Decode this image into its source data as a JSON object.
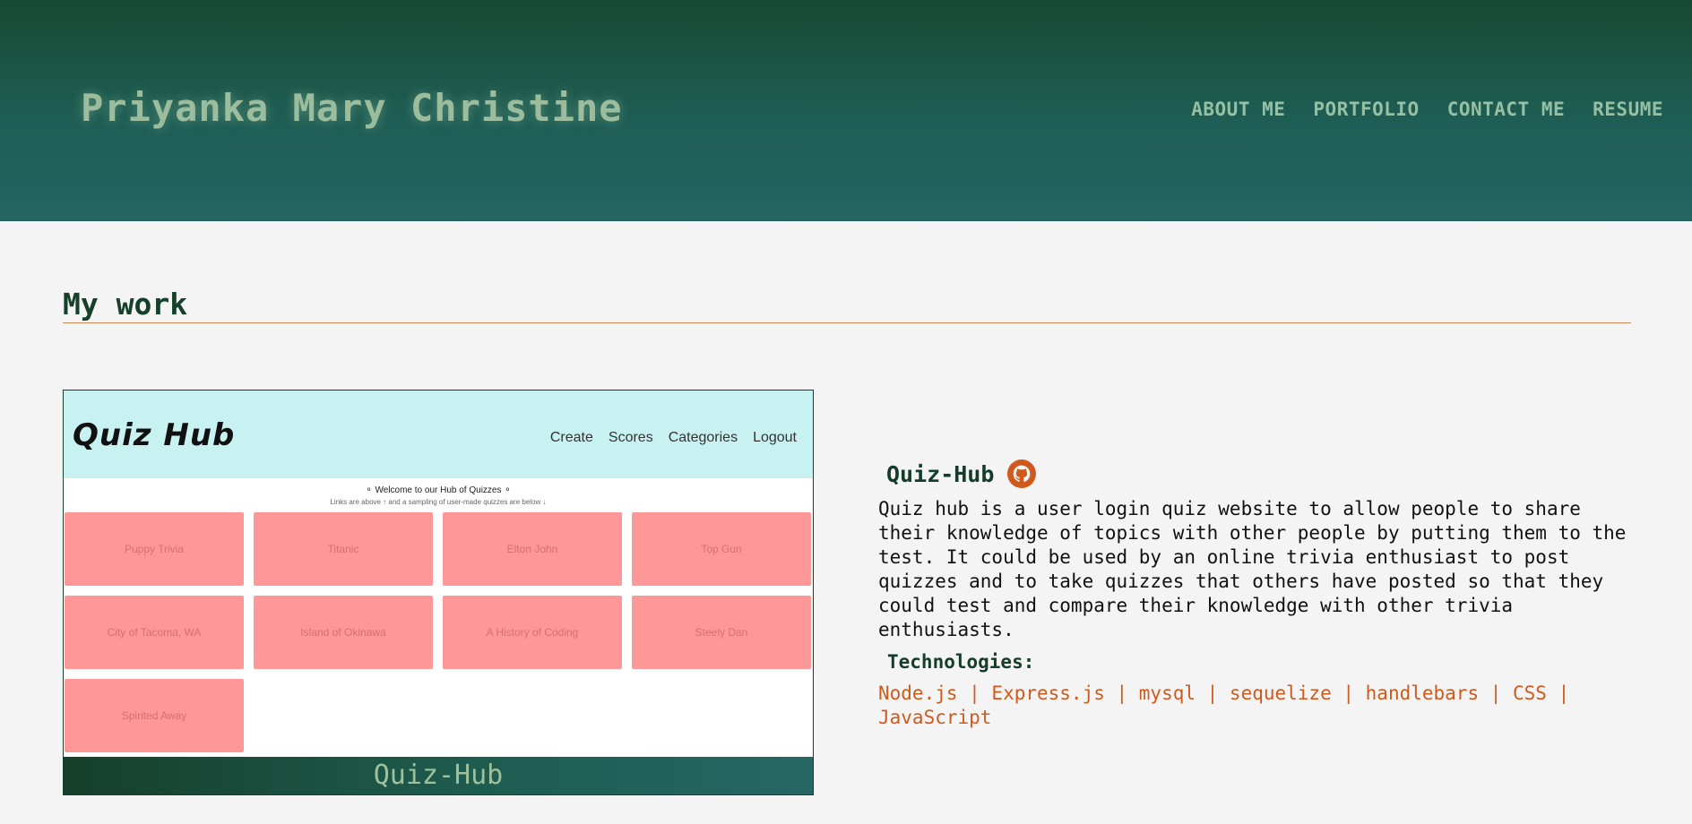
{
  "header": {
    "site_title": "Priyanka Mary Christine",
    "nav": [
      "ABOUT ME",
      "PORTFOLIO",
      "CONTACT ME",
      "RESUME"
    ]
  },
  "section": {
    "title": "My work"
  },
  "project": {
    "screenshot": {
      "logo": "Quiz Hub",
      "nav": [
        "Create",
        "Scores",
        "Categories",
        "Logout"
      ],
      "welcome": "⚬ Welcome to our Hub of Quizzes ⚬",
      "subtext": "Links are above ↑ and a sampling of user-made quizzes are below ↓",
      "tiles": [
        "Puppy Trivia",
        "Titanic",
        "Elton John",
        "Top Gun",
        "City of Tacoma, WA",
        "Island of Okinawa",
        "A History of Coding",
        "Steely Dan",
        "Spirited Away"
      ]
    },
    "caption": "Quiz-Hub",
    "title": "Quiz-Hub",
    "github_icon": "github-icon",
    "description": "Quiz hub is a user login quiz website to allow people to share their knowledge of topics with other people by putting them to the test. It could be used by an online trivia enthusiast to post quizzes and to take quizzes that others have posted so that they could test and compare their knowledge with other trivia enthusiasts.",
    "tech_label": "Technologies:",
    "technologies": "Node.js | Express.js | mysql | sequelize | handlebars | CSS | JavaScript"
  },
  "colors": {
    "header_dark": "#164a33",
    "header_light": "#246563",
    "accent": "#cf5a1e",
    "tile": "#fe9898",
    "screenshot_bar": "#c8f2f2"
  }
}
